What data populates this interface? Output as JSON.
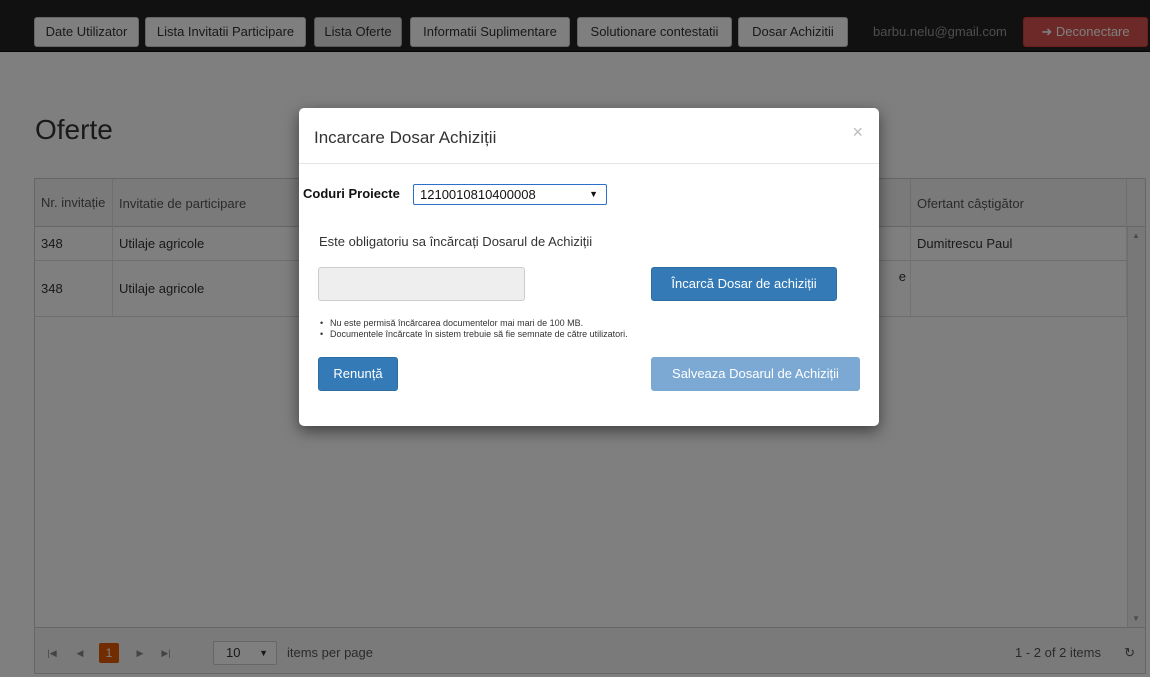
{
  "navbar": {
    "buttons": [
      {
        "label": "Date Utilizator",
        "active": false
      },
      {
        "label": "Lista Invitatii Participare",
        "active": false
      },
      {
        "label": "Lista Oferte",
        "active": true
      },
      {
        "label": "Informatii Suplimentare",
        "active": false
      },
      {
        "label": "Solutionare contestatii",
        "active": false
      },
      {
        "label": "Dosar Achizitii",
        "active": false
      }
    ],
    "user_email": "barbu.nelu@gmail.com",
    "logout_label": "Deconectare",
    "logout_icon": "logout-icon"
  },
  "page": {
    "title": "Oferte"
  },
  "grid": {
    "columns": [
      "Nr. invitație",
      "Invitatie de participare",
      "",
      "",
      "",
      "Ofertant câștigător"
    ],
    "rows": [
      [
        "348",
        "Utilaje agricole",
        "",
        "",
        "",
        "Dumitrescu Paul"
      ],
      [
        "348",
        "Utilaje agricole",
        "",
        "",
        "e",
        ""
      ]
    ]
  },
  "pager": {
    "current_page": "1",
    "page_size": "10",
    "items_per_page_label": "items per page",
    "info": "1 - 2 of 2 items"
  },
  "modal": {
    "title": "Incarcare Dosar Achiziții",
    "close_glyph": "×",
    "codes_label": "Coduri Proiecte",
    "codes_value": "1210010810400008",
    "mandatory_text": "Este obligatoriu sa încărcați Dosarul de Achiziții",
    "upload_label": "Încarcă Dosar de achiziții",
    "notes": [
      "Nu este permisă încărcarea documentelor mai mari de 100 MB.",
      "Documentele încărcate în sistem trebuie să fie semnate de către utilizatori."
    ],
    "cancel_label": "Renunță",
    "save_label": "Salveaza Dosarul de Achiziții"
  },
  "colors": {
    "accent": "#337ab7",
    "danger": "#d9534f",
    "pager_current": "#e35b00"
  }
}
